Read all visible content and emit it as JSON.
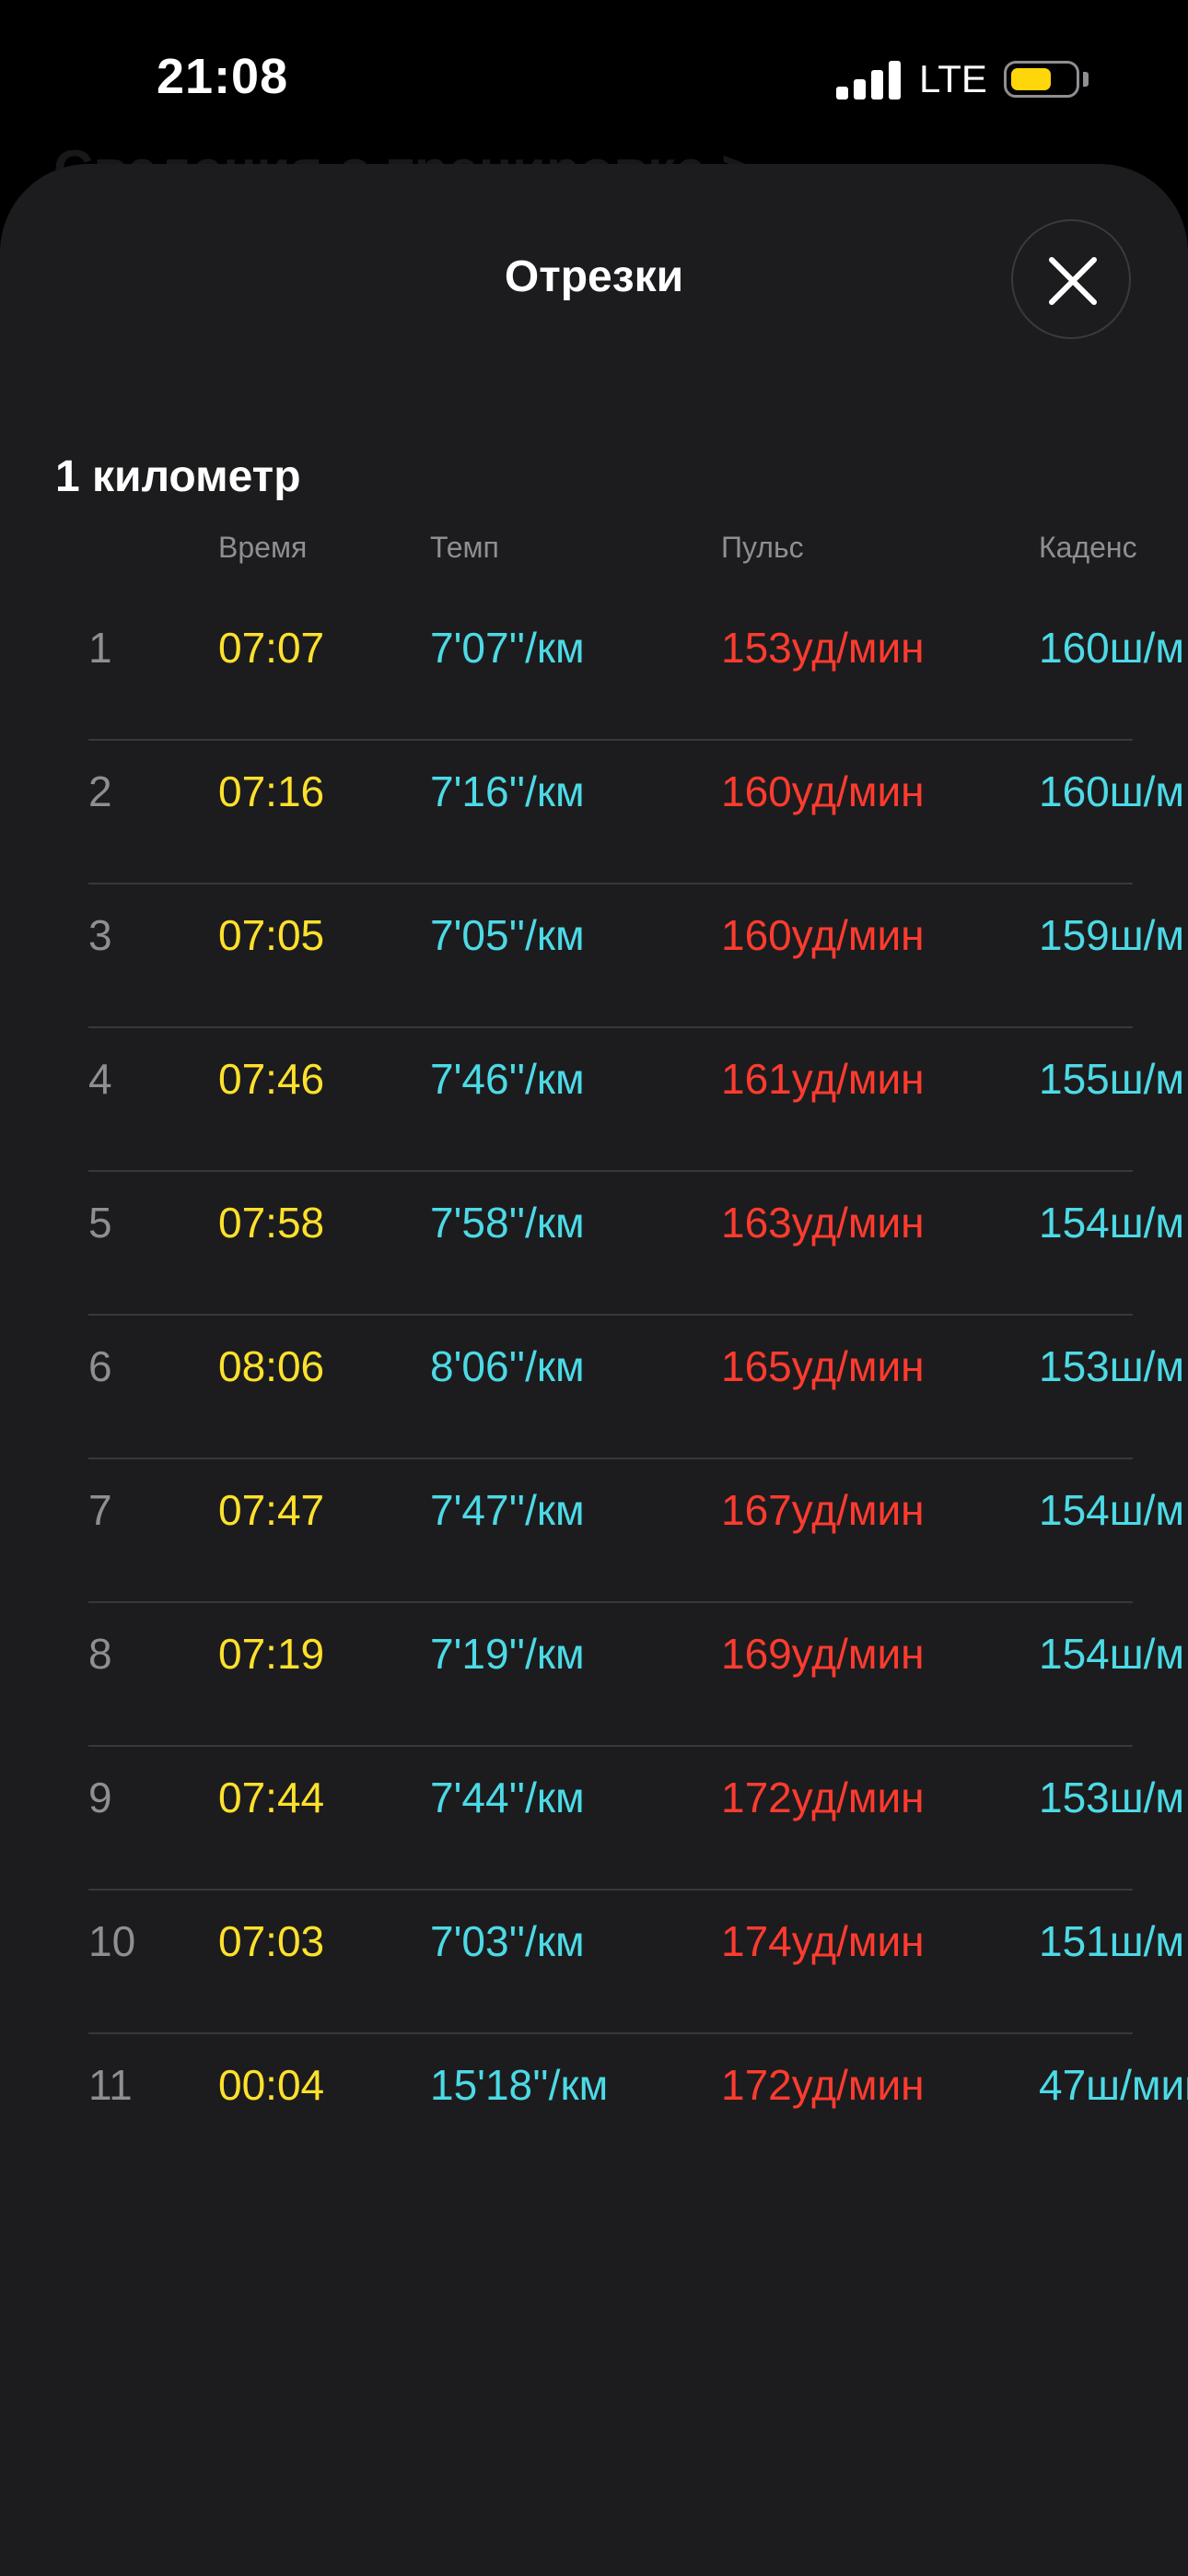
{
  "status_bar": {
    "time": "21:08",
    "network": "LTE",
    "battery_level": 0.62
  },
  "background": {
    "title": "Сведения о тренировке >"
  },
  "sheet": {
    "title": "Отрезки",
    "section_title": "1 километр",
    "columns": [
      "Время",
      "Темп",
      "Пульс",
      "Каденс"
    ],
    "rows": [
      {
        "index": "1",
        "time": "07:07",
        "pace": "7'07''/км",
        "heart_rate": "153уд/мин",
        "cadence": "160ш/м"
      },
      {
        "index": "2",
        "time": "07:16",
        "pace": "7'16''/км",
        "heart_rate": "160уд/мин",
        "cadence": "160ш/м"
      },
      {
        "index": "3",
        "time": "07:05",
        "pace": "7'05''/км",
        "heart_rate": "160уд/мин",
        "cadence": "159ш/м"
      },
      {
        "index": "4",
        "time": "07:46",
        "pace": "7'46''/км",
        "heart_rate": "161уд/мин",
        "cadence": "155ш/м"
      },
      {
        "index": "5",
        "time": "07:58",
        "pace": "7'58''/км",
        "heart_rate": "163уд/мин",
        "cadence": "154ш/м"
      },
      {
        "index": "6",
        "time": "08:06",
        "pace": "8'06''/км",
        "heart_rate": "165уд/мин",
        "cadence": "153ш/м"
      },
      {
        "index": "7",
        "time": "07:47",
        "pace": "7'47''/км",
        "heart_rate": "167уд/мин",
        "cadence": "154ш/м"
      },
      {
        "index": "8",
        "time": "07:19",
        "pace": "7'19''/км",
        "heart_rate": "169уд/мин",
        "cadence": "154ш/м"
      },
      {
        "index": "9",
        "time": "07:44",
        "pace": "7'44''/км",
        "heart_rate": "172уд/мин",
        "cadence": "153ш/м"
      },
      {
        "index": "10",
        "time": "07:03",
        "pace": "7'03''/км",
        "heart_rate": "174уд/мин",
        "cadence": "151ш/м"
      },
      {
        "index": "11",
        "time": "00:04",
        "pace": "15'18''/км",
        "heart_rate": "172уд/мин",
        "cadence": "47ш/мин"
      }
    ]
  },
  "colors": {
    "time": "#ffe12b",
    "pace": "#4cdae6",
    "heart_rate": "#ff3b2f",
    "cadence": "#4cdae6",
    "sheet_bg": "#1c1c1e"
  },
  "icons": {
    "close": "close-icon",
    "signal": "cellular-signal-icon",
    "battery": "battery-icon"
  }
}
